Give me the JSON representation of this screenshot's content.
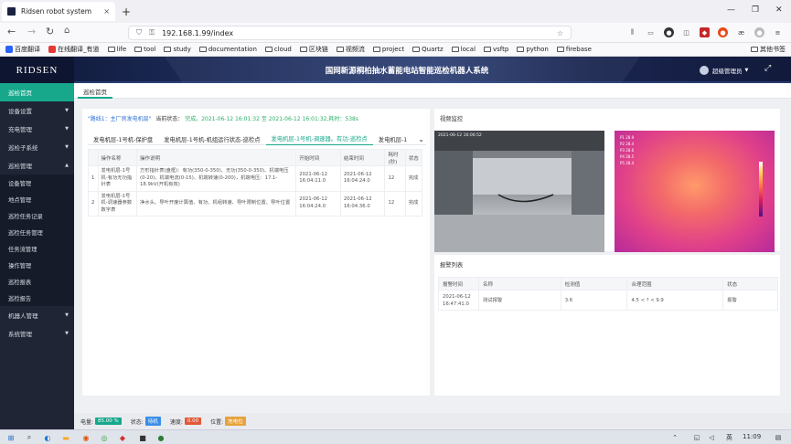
{
  "browser": {
    "tab_title": "Ridsen robot system",
    "tab_close": "×",
    "new_tab": "+",
    "url": "192.168.1.99/index",
    "window_controls": [
      "—",
      "❐",
      "✕"
    ],
    "bookmarks": [
      "百度翻译",
      "在线翻译_有道",
      "life",
      "tool",
      "study",
      "documentation",
      "cloud",
      "区块链",
      "视频流",
      "project",
      "Quartz",
      "local",
      "vsftp",
      "python",
      "firebase"
    ],
    "other_bookmarks": "其他书签"
  },
  "app": {
    "logo": "RIDSEN",
    "title": "国网新源桐柏抽水蓄能电站智能巡检机器人系统",
    "user": "超级管理员",
    "top_tab": "巡检首页"
  },
  "sidebar": {
    "items": [
      {
        "label": "巡检首页",
        "active": true
      },
      {
        "label": "设备设置",
        "arrow": "▼"
      },
      {
        "label": "充电管理",
        "arrow": "▼"
      },
      {
        "label": "巡检子系统",
        "arrow": "▼"
      },
      {
        "label": "巡检管理",
        "arrow": "▲"
      },
      {
        "label": "设备管理",
        "sub": true
      },
      {
        "label": "地点管理",
        "sub": true
      },
      {
        "label": "巡检任务记录",
        "sub": true
      },
      {
        "label": "巡检任务管理",
        "sub": true
      },
      {
        "label": "任务流管理",
        "sub": true
      },
      {
        "label": "操作管理",
        "sub": true
      },
      {
        "label": "巡检报表",
        "sub": true
      },
      {
        "label": "巡检报告",
        "sub": true
      },
      {
        "label": "机器人管理",
        "arrow": "▼"
      },
      {
        "label": "系统管理",
        "arrow": "▼"
      }
    ]
  },
  "task": {
    "route": "\"路线1：主厂房发电机层\"",
    "status_label": "当前状态：",
    "status": "完成。2021-06-12 16:01:32 至 2021-06-12 16:01:32,耗时：538s",
    "tabs": [
      "发电机层-1号机-保护盘",
      "发电机层-1号机-机组运行状态-巡检点",
      "发电机层-1号机-调速器。有功-巡检点",
      "发电机层-1"
    ],
    "active_tab": 2,
    "dropdown": "⌄",
    "columns": [
      "",
      "操作名称",
      "操作说明",
      "开始时间",
      "结束时间",
      "耗时(秒)",
      "状态"
    ],
    "rows": [
      {
        "idx": "1",
        "name": "发电机层-1号机-有功无功指针表",
        "desc": "方形指针表(盘框)：有功(350-0-350)、无功(350-0-350)、机端电压(0-20)、机端电流(0-15)、机端转速(0-200)，机端电压：17.1-18.9kV(开机有效)",
        "start": "2021-06-12 16:04:11.0",
        "end": "2021-06-12 16:04:24.0",
        "dur": "12",
        "status": "完成"
      },
      {
        "idx": "2",
        "name": "发电机层-1号机-调速器参数数字表",
        "desc": "净水头、导叶开度计算值、有功、机组转速、导叶限制位置、导叶位置",
        "start": "2021-06-12 16:04:24.0",
        "end": "2021-06-12 16:04:36.0",
        "dur": "12",
        "status": "完成"
      }
    ]
  },
  "video": {
    "title": "视频监控",
    "visible_timestamp": "2021-06-12 16:06:52",
    "thermal_labels": [
      "P1 28.9",
      "P2 28.4",
      "P3 28.6",
      "P4 28.5",
      "P5 28.4"
    ]
  },
  "alarm": {
    "title": "报警列表",
    "columns": [
      "报警时间",
      "名称",
      "检测值",
      "合理范围",
      "状态"
    ],
    "rows": [
      {
        "time": "2021-06-12 16:47:41.0",
        "name": "测试报警",
        "value": "3.6",
        "range": "4.5 < ? < 9.9",
        "status": "报警"
      }
    ]
  },
  "status_bar": {
    "battery_label": "电量:",
    "battery": "85.00 %",
    "state_label": "状态:",
    "state": "待机",
    "speed_label": "速度:",
    "speed": "0.00",
    "position_label": "位置:",
    "position": "充电位",
    "colors": {
      "battery": "#17a88c",
      "state": "#3a8ee6",
      "speed": "#e05a3a",
      "position": "#e6a23c"
    }
  },
  "taskbar": {
    "time": "11:09",
    "lang": "英"
  }
}
